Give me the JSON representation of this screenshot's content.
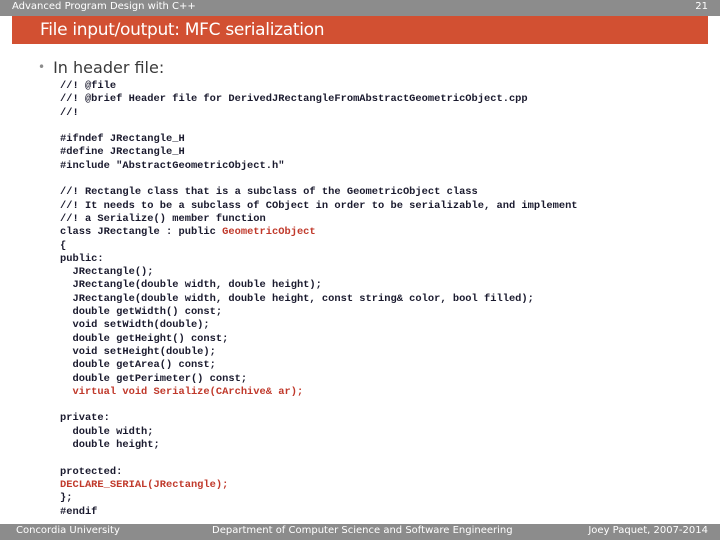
{
  "header": {
    "course": "Advanced Program Design with C++",
    "page_number": "21"
  },
  "slide": {
    "title": "File input/output: MFC serialization",
    "bullet": "In header file:"
  },
  "code_lines": [
    [
      {
        "t": "//! @file",
        "c": "n"
      }
    ],
    [
      {
        "t": "//! @brief Header file for DerivedJRectangleFromAbstractGeometricObject.cpp",
        "c": "n"
      }
    ],
    [
      {
        "t": "//!",
        "c": "n"
      }
    ],
    [
      {
        "t": "",
        "c": "n"
      }
    ],
    [
      {
        "t": "#ifndef JRectangle_H",
        "c": "n"
      }
    ],
    [
      {
        "t": "#define JRectangle_H",
        "c": "n"
      }
    ],
    [
      {
        "t": "#include \"AbstractGeometricObject.h\"",
        "c": "n"
      }
    ],
    [
      {
        "t": "",
        "c": "n"
      }
    ],
    [
      {
        "t": "//! Rectangle class that is a subclass of the GeometricObject class",
        "c": "n"
      }
    ],
    [
      {
        "t": "//! It needs to be a subclass of CObject in order to be serializable, and implement",
        "c": "n"
      }
    ],
    [
      {
        "t": "//! a Serialize() member function",
        "c": "n"
      }
    ],
    [
      {
        "t": "class JRectangle : public ",
        "c": "n"
      },
      {
        "t": "GeometricObject",
        "c": "r"
      }
    ],
    [
      {
        "t": "{",
        "c": "n"
      }
    ],
    [
      {
        "t": "public:",
        "c": "n"
      }
    ],
    [
      {
        "t": "  JRectangle();",
        "c": "n"
      }
    ],
    [
      {
        "t": "  JRectangle(double width, double height);",
        "c": "n"
      }
    ],
    [
      {
        "t": "  JRectangle(double width, double height, const string& color, bool filled);",
        "c": "n"
      }
    ],
    [
      {
        "t": "  double getWidth() const;",
        "c": "n"
      }
    ],
    [
      {
        "t": "  void setWidth(double);",
        "c": "n"
      }
    ],
    [
      {
        "t": "  double getHeight() const;",
        "c": "n"
      }
    ],
    [
      {
        "t": "  void setHeight(double);",
        "c": "n"
      }
    ],
    [
      {
        "t": "  double getArea() const;",
        "c": "n"
      }
    ],
    [
      {
        "t": "  double getPerimeter() const;",
        "c": "n"
      }
    ],
    [
      {
        "t": "  virtual void Serialize(CArchive& ar);",
        "c": "r"
      }
    ],
    [
      {
        "t": "",
        "c": "n"
      }
    ],
    [
      {
        "t": "private:",
        "c": "n"
      }
    ],
    [
      {
        "t": "  double width;",
        "c": "n"
      }
    ],
    [
      {
        "t": "  double height;",
        "c": "n"
      }
    ],
    [
      {
        "t": "",
        "c": "n"
      }
    ],
    [
      {
        "t": "protected:",
        "c": "n"
      }
    ],
    [
      {
        "t": "DECLARE_SERIAL(JRectangle);",
        "c": "r"
      }
    ],
    [
      {
        "t": "};",
        "c": "n"
      }
    ],
    [
      {
        "t": "#endif",
        "c": "n"
      }
    ]
  ],
  "footer": {
    "left": "Concordia University",
    "center": "Department of Computer Science and Software Engineering",
    "right": "Joey Paquet, 2007-2014"
  },
  "colors": {
    "title_bar": "#d25032",
    "gray_bars": "#8c8c8c",
    "code_highlight": "#c0392b"
  }
}
